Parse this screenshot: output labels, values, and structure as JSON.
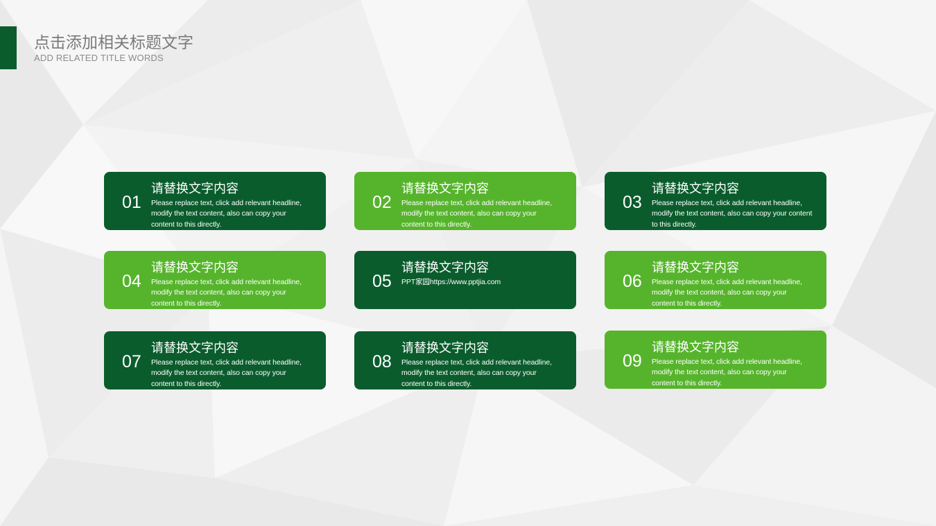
{
  "colors": {
    "dark_green": "#0b5c2d",
    "light_green": "#56b42c",
    "accent_bar": "#0b5c2d",
    "text_white": "#ffffff"
  },
  "header": {
    "title": "点击添加相关标题文字",
    "subtitle": "ADD RELATED TITLE WORDS"
  },
  "cards": [
    {
      "number": "01",
      "heading": "请替换文字内容",
      "body": "Please replace text, click add relevant headline, modify the text content, also can copy your content to this directly.",
      "variant": "dark"
    },
    {
      "number": "02",
      "heading": "请替换文字内容",
      "body": "Please replace text, click add relevant headline, modify the text content, also can copy your content to this directly.",
      "variant": "light"
    },
    {
      "number": "03",
      "heading": "请替换文字内容",
      "body": "Please replace text, click add relevant headline, modify the text content, also can copy your content to this directly.",
      "variant": "dark"
    },
    {
      "number": "04",
      "heading": "请替换文字内容",
      "body": "Please replace text, click add relevant headline, modify the text content, also can copy your content to this directly.",
      "variant": "light"
    },
    {
      "number": "05",
      "heading": "请替换文字内容",
      "body": "PPT家园https://www.pptjia.com",
      "variant": "dark"
    },
    {
      "number": "06",
      "heading": "请替换文字内容",
      "body": "Please replace text, click add relevant headline, modify the text content, also can copy your content to this directly.",
      "variant": "light"
    },
    {
      "number": "07",
      "heading": "请替换文字内容",
      "body": "Please replace text, click add relevant headline, modify the text content, also can copy your content to this directly.",
      "variant": "dark"
    },
    {
      "number": "08",
      "heading": "请替换文字内容",
      "body": "Please replace text, click add relevant headline, modify the text content, also can copy your content to this directly.",
      "variant": "dark"
    },
    {
      "number": "09",
      "heading": "请替换文字内容",
      "body": "Please replace text, click add relevant headline, modify the text content, also can copy your content to this directly.",
      "variant": "light"
    }
  ]
}
